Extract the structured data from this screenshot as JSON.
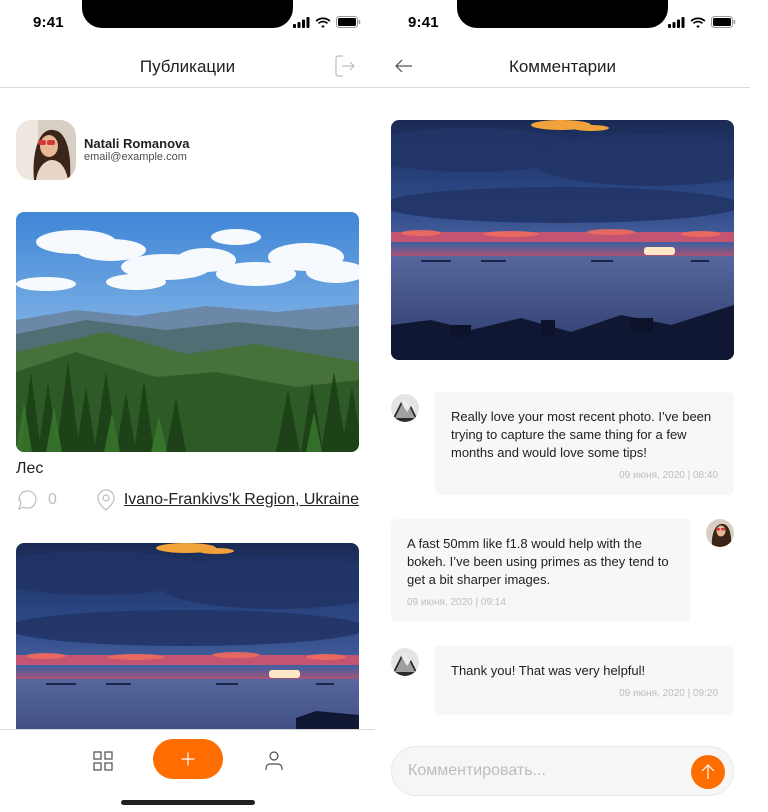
{
  "status_bar": {
    "time": "9:41"
  },
  "posts_screen": {
    "title": "Публикации",
    "user": {
      "name": "Natali Romanova",
      "email": "email@example.com"
    },
    "posts": [
      {
        "title": "Лес",
        "comments_count": "0",
        "location": "Ivano-Frankivs'k Region, Ukraine",
        "image": "forest-mountains-photo"
      },
      {
        "title": "",
        "image": "sunset-sea-photo"
      }
    ]
  },
  "tabbar": {
    "icons": [
      "grid-icon",
      "plus-icon",
      "user-icon"
    ]
  },
  "comments_screen": {
    "title": "Комментарии",
    "image": "sunset-sea-photo",
    "comments": [
      {
        "author": "other",
        "text": "Really love your most recent photo. I’ve been trying to capture the same thing for a few months and would love some tips!",
        "date": "09 июня, 2020 | 08:40"
      },
      {
        "author": "me",
        "text": "A fast 50mm like f1.8 would help with the bokeh. I’ve been using primes as they tend to get a bit sharper images.",
        "date": "09 июня, 2020 | 09:14"
      },
      {
        "author": "other",
        "text": "Thank you! That was very helpful!",
        "date": "09 июня, 2020 | 09:20"
      }
    ],
    "input_placeholder": "Комментировать..."
  },
  "colors": {
    "accent": "#FF6C00",
    "text": "#212121",
    "muted": "#BDBDBD",
    "border": "#E8E8E8"
  }
}
